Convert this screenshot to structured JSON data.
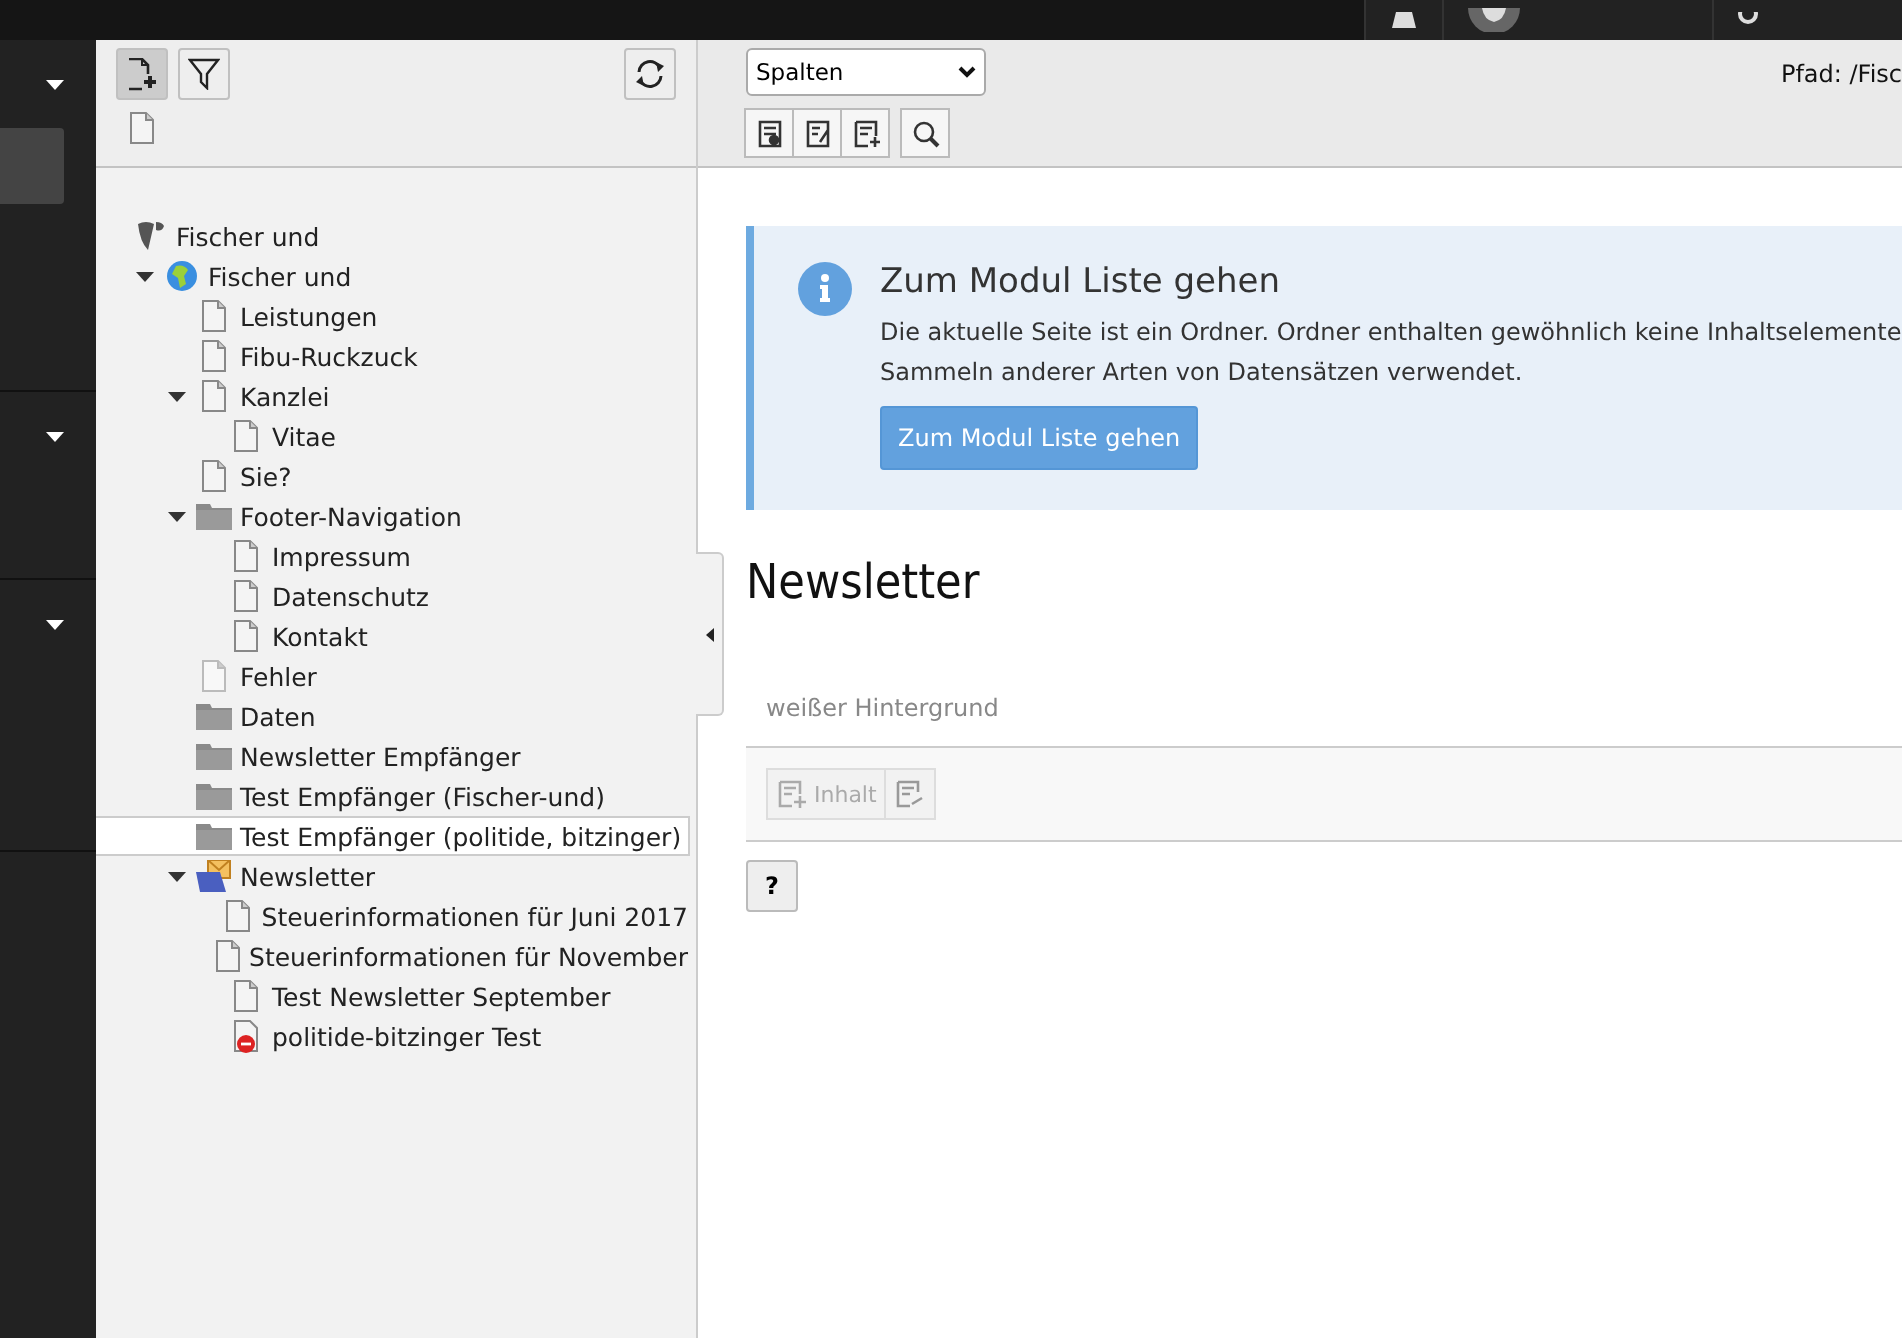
{
  "tree": {
    "label": "Fischer und",
    "kind": "root",
    "selected": false,
    "children": [
      {
        "label": "Fischer und",
        "kind": "site",
        "expanded": true,
        "selected": false,
        "children": [
          {
            "label": "Leistungen",
            "kind": "page",
            "selected": false
          },
          {
            "label": "Fibu-Ruckzuck",
            "kind": "page",
            "selected": false
          },
          {
            "label": "Kanzlei",
            "kind": "page",
            "expanded": true,
            "selected": false,
            "children": [
              {
                "label": "Vitae",
                "kind": "page",
                "selected": false
              }
            ]
          },
          {
            "label": "Sie?",
            "kind": "page",
            "selected": false
          },
          {
            "label": "Footer-Navigation",
            "kind": "folder",
            "expanded": true,
            "selected": false,
            "children": [
              {
                "label": "Impressum",
                "kind": "page",
                "selected": false
              },
              {
                "label": "Datenschutz",
                "kind": "page",
                "selected": false
              },
              {
                "label": "Kontakt",
                "kind": "page",
                "selected": false
              }
            ]
          },
          {
            "label": "Fehler",
            "kind": "hidden-page",
            "selected": false
          },
          {
            "label": "Daten",
            "kind": "folder",
            "selected": false
          },
          {
            "label": "Newsletter Empfänger",
            "kind": "folder",
            "selected": false
          },
          {
            "label": "Test Empfänger (Fischer-und)",
            "kind": "folder",
            "selected": false
          },
          {
            "label": "Test Empfänger (politide, bitzinger)",
            "kind": "folder",
            "selected": true
          },
          {
            "label": "Newsletter",
            "kind": "newsletter",
            "expanded": true,
            "selected": false,
            "children": [
              {
                "label": "Steuerinformationen für Juni 2017",
                "kind": "page",
                "selected": false
              },
              {
                "label": "Steuerinformationen für November",
                "kind": "page",
                "selected": false
              },
              {
                "label": "Test Newsletter September",
                "kind": "page",
                "selected": false
              },
              {
                "label": "politide-bitzinger Test",
                "kind": "error-page",
                "selected": false
              }
            ]
          }
        ]
      }
    ]
  },
  "module_select": {
    "value": "Spalten"
  },
  "path": "Pfad: /Fisc",
  "callout": {
    "title": "Zum Modul Liste gehen",
    "lines": [
      "Die aktuelle Seite ist ein Ordner. Ordner enthalten gewöhnlich keine Inhaltselemente",
      "Sammeln anderer Arten von Datensätzen verwendet."
    ],
    "button": "Zum Modul Liste gehen"
  },
  "page_title": "Newsletter",
  "section": {
    "title": "weißer Hintergrund",
    "button": "Inhalt"
  },
  "help_button": "?"
}
